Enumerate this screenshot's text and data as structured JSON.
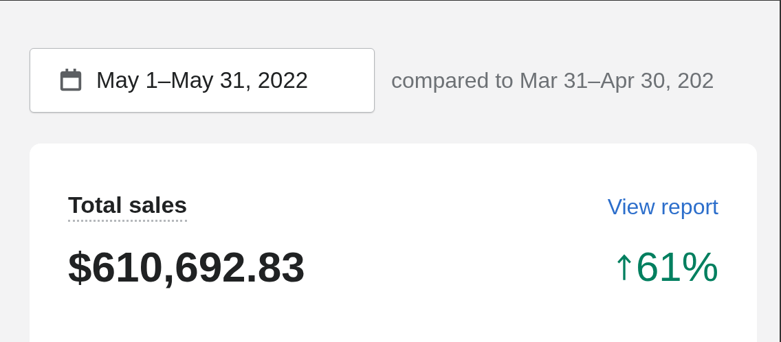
{
  "date_range": {
    "label": "May 1–May 31, 2022",
    "comparison": "compared to Mar 31–Apr 30, 202"
  },
  "card": {
    "title": "Total sales",
    "link": "View report",
    "value": "$610,692.83",
    "trend": {
      "up": true,
      "change": "61%"
    }
  }
}
